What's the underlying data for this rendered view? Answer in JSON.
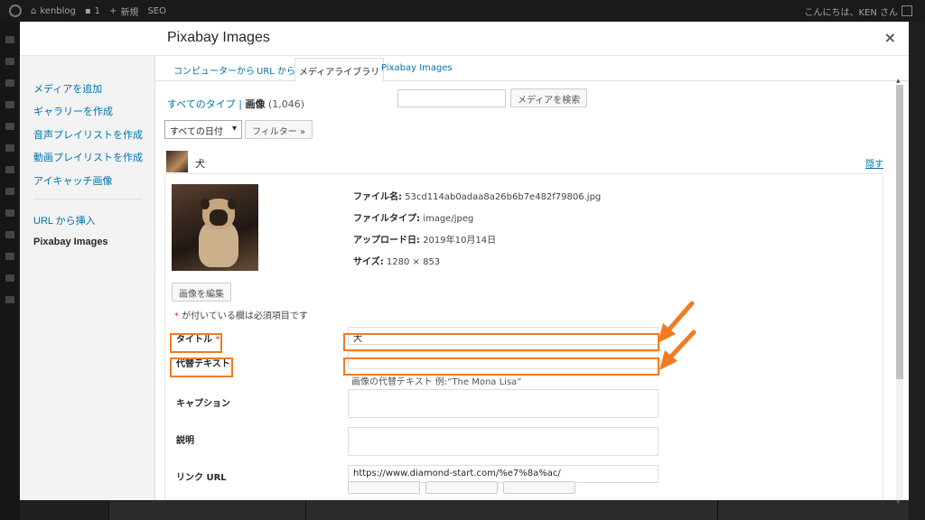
{
  "adminbar": {
    "site_name": "kenblog",
    "comments_count": "1",
    "new_label": "新規",
    "seo_label": "SEO",
    "greeting": "こんにちは、KEN さん"
  },
  "modal": {
    "title": "Pixabay Images",
    "close_symbol": "×"
  },
  "media_menu": {
    "items": [
      {
        "label": "メディアを追加"
      },
      {
        "label": "ギャラリーを作成"
      },
      {
        "label": "音声プレイリストを作成"
      },
      {
        "label": "動画プレイリストを作成"
      },
      {
        "label": "アイキャッチ画像"
      },
      {
        "label": "URL から挿入"
      },
      {
        "label": "Pixabay Images"
      }
    ]
  },
  "router": {
    "tabs": [
      {
        "label": "コンピューターから"
      },
      {
        "label": "URL から"
      },
      {
        "label": "メディアライブラリ"
      },
      {
        "label": "Pixabay Images"
      }
    ]
  },
  "filters": {
    "all_types": "すべてのタイプ",
    "separator": " | ",
    "images": "画像",
    "images_count": "(1,046)",
    "search_button": "メディアを検索",
    "date_select": "すべての日付",
    "filter_button": "フィルター »"
  },
  "attachment": {
    "name": "犬",
    "hide_link": "隠す",
    "file_name_label": "ファイル名:",
    "file_name": "53cd114ab0adaa8a26b6b7e482f79806.jpg",
    "file_type_label": "ファイルタイプ:",
    "file_type": "image/jpeg",
    "upload_date_label": "アップロード日:",
    "upload_date": "2019年10月14日",
    "size_label": "サイズ:",
    "size": "1280 × 853",
    "edit_image_button": "画像を編集",
    "required_star": "*",
    "required_note": " が付いている欄は必須項目です"
  },
  "fields": {
    "title_label": "タイトル",
    "title_star": "*",
    "title_value": "犬",
    "alt_label": "代替テキスト",
    "alt_value": "",
    "alt_help": "画像の代替テキスト 例:“The Mona Lisa”",
    "caption_label": "キャプション",
    "description_label": "説明",
    "link_label": "リンク URL",
    "link_value": "https://www.diamond-start.com/%e7%8a%ac/"
  },
  "colors": {
    "highlight": "#f07c22",
    "link": "#0073aa",
    "required": "#dc3232"
  }
}
